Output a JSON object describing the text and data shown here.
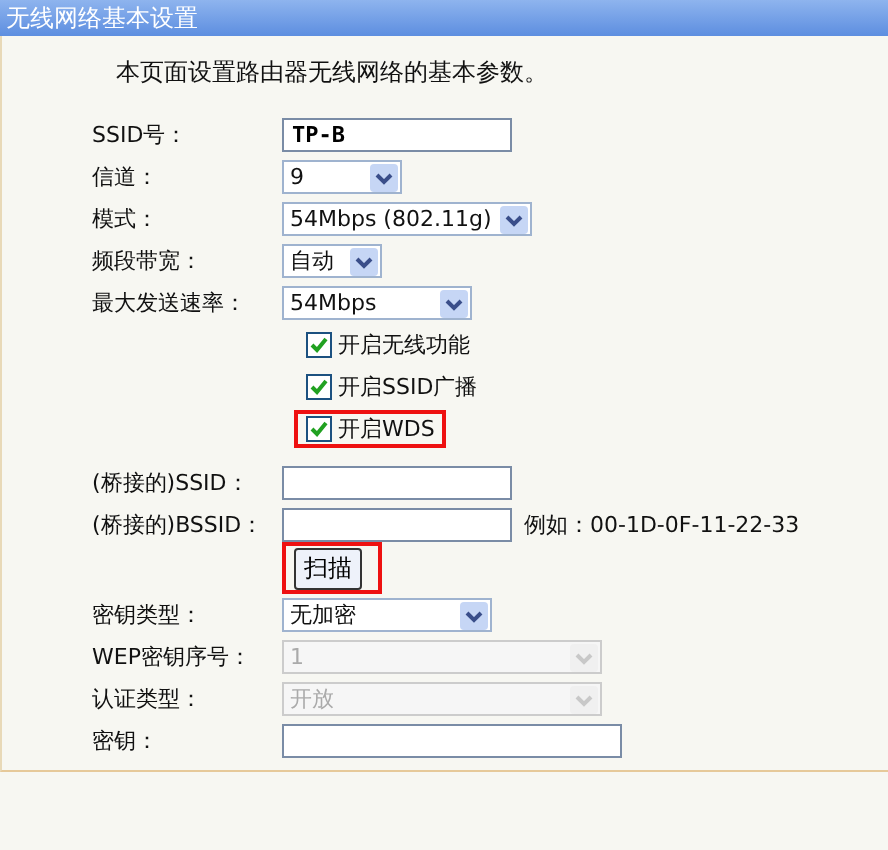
{
  "window": {
    "title": "无线网络基本设置"
  },
  "description": "本页面设置路由器无线网络的基本参数。",
  "fields": [
    {
      "kind": "text",
      "label": "SSID号：",
      "value": "TP-B"
    },
    {
      "kind": "select",
      "label": "信道：",
      "value": "9",
      "disabled": false
    },
    {
      "kind": "select",
      "label": "模式：",
      "value": "54Mbps (802.11g)",
      "disabled": false
    },
    {
      "kind": "select",
      "label": "频段带宽：",
      "value": "自动",
      "disabled": false
    },
    {
      "kind": "select",
      "label": "最大发送速率：",
      "value": "54Mbps",
      "disabled": false
    },
    {
      "kind": "checkbox",
      "label": "开启无线功能",
      "checked": true,
      "highlighted": false
    },
    {
      "kind": "checkbox",
      "label": "开启SSID广播",
      "checked": true,
      "highlighted": false
    },
    {
      "kind": "checkbox",
      "label": "开启WDS",
      "checked": true,
      "highlighted": true
    },
    {
      "kind": "gap"
    },
    {
      "kind": "text",
      "label": "(桥接的)SSID："
    },
    {
      "kind": "text",
      "label": "(桥接的)BSSID：",
      "hint": "例如：00-1D-0F-11-22-33"
    },
    {
      "kind": "button",
      "label": "扫描",
      "highlighted": true
    },
    {
      "kind": "select",
      "label": "密钥类型：",
      "value": "无加密",
      "disabled": false
    },
    {
      "kind": "select",
      "label": "WEP密钥序号：",
      "value": "1",
      "disabled": true
    },
    {
      "kind": "select",
      "label": "认证类型：",
      "value": "开放",
      "disabled": true
    },
    {
      "kind": "text",
      "label": "密钥："
    }
  ]
}
